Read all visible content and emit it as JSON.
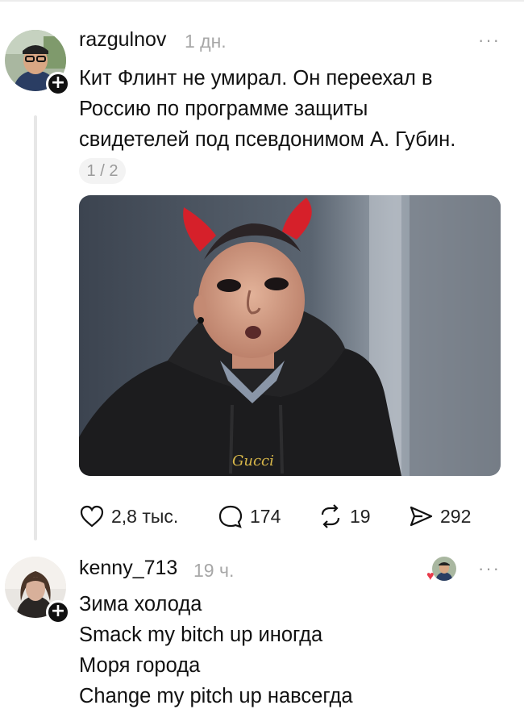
{
  "post": {
    "username": "razgulnov",
    "time": "1 дн.",
    "more": "···",
    "lines": [
      "Кит Флинт не умирал. Он переехал в",
      "Россию по программе защиты",
      "свидетелей под псевдонимом А. Губин."
    ],
    "page_indicator": "1 / 2",
    "photo_text": "Gucci",
    "actions": {
      "likes": "2,8 тыс.",
      "comments": "174",
      "reposts": "19",
      "shares": "292"
    }
  },
  "reply": {
    "username": "kenny_713",
    "time": "19 ч.",
    "more": "···",
    "lines": [
      "Зима холода",
      "Smack my bitch up иногда",
      "Моря города",
      "Change my pitch up навсегда"
    ]
  },
  "colors": {
    "text": "#111111",
    "muted": "#a7a7a7",
    "heart_badge": "#e83a4a"
  },
  "icons": {
    "plus": "plus-icon",
    "like": "heart-icon",
    "comment": "comment-bubble-icon",
    "repost": "repost-icon",
    "share": "send-icon"
  }
}
